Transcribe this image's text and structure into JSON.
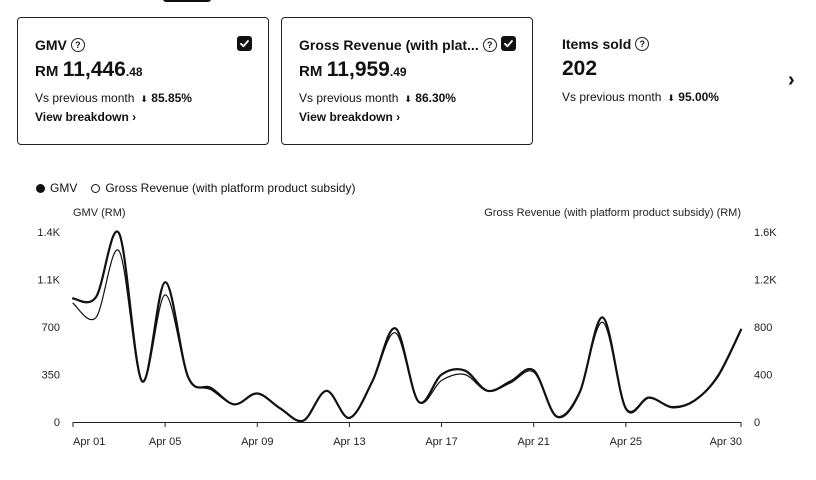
{
  "cards": [
    {
      "title": "GMV",
      "currency": "RM",
      "value_int": "11,446",
      "value_dec": ".48",
      "compare_label": "Vs previous month",
      "compare_pct": "85.85%",
      "link": "View breakdown",
      "checked": true
    },
    {
      "title": "Gross Revenue (with plat...",
      "currency": "RM",
      "value_int": "11,959",
      "value_dec": ".49",
      "compare_label": "Vs previous month",
      "compare_pct": "86.30%",
      "link": "View breakdown",
      "checked": true
    },
    {
      "title": "Items sold",
      "value_int": "202",
      "compare_label": "Vs previous month",
      "compare_pct": "95.00%",
      "checked": false
    }
  ],
  "icons": {
    "help": "question-circle-icon",
    "check": "checkmark-icon",
    "trend_down": "arrow-down-icon",
    "link_chevron": "chevron-right-icon",
    "next": "chevron-right-icon"
  },
  "glyphs": {
    "help": "?",
    "down": "⬇",
    "link_chevron": "›",
    "next": "›"
  },
  "chart_data": {
    "type": "line",
    "legend": [
      "GMV",
      "Gross Revenue (with platform product subsidy)"
    ],
    "legend_position": "top-left",
    "ylabel_left": "GMV (RM)",
    "ylabel_right": "Gross Revenue (with platform product subsidy) (RM)",
    "y_ticks_left": [
      "0",
      "350",
      "700",
      "1.1K",
      "1.4K"
    ],
    "y_ticks_right": [
      "0",
      "400",
      "800",
      "1.2K",
      "1.6K"
    ],
    "ylim_left": [
      0,
      1400
    ],
    "ylim_right": [
      0,
      1600
    ],
    "x_tick_labels": [
      "Apr 01",
      "Apr 05",
      "Apr 09",
      "Apr 13",
      "Apr 17",
      "Apr 21",
      "Apr 25",
      "Apr 30"
    ],
    "x_tick_days": [
      1,
      5,
      9,
      13,
      17,
      21,
      25,
      30
    ],
    "grid": false,
    "x": [
      1,
      2,
      3,
      4,
      5,
      6,
      7,
      8,
      9,
      10,
      11,
      12,
      13,
      14,
      15,
      16,
      17,
      18,
      19,
      20,
      21,
      22,
      23,
      24,
      25,
      26,
      27,
      28,
      29,
      30
    ],
    "series": [
      {
        "name": "GMV",
        "axis": "left",
        "color": "#111111",
        "values": [
          910,
          920,
          1390,
          300,
          1030,
          330,
          250,
          130,
          210,
          100,
          10,
          230,
          30,
          300,
          690,
          150,
          350,
          380,
          230,
          300,
          380,
          40,
          220,
          770,
          100,
          180,
          110,
          160,
          340,
          680
        ]
      },
      {
        "name": "Gross Revenue (with platform product subsidy)",
        "axis": "right",
        "color": "#111111",
        "dashed": true,
        "values": [
          1000,
          880,
          1440,
          340,
          1070,
          380,
          270,
          150,
          240,
          110,
          10,
          260,
          30,
          340,
          750,
          170,
          350,
          400,
          260,
          330,
          420,
          50,
          260,
          840,
          120,
          210,
          120,
          180,
          380,
          770
        ]
      }
    ]
  }
}
